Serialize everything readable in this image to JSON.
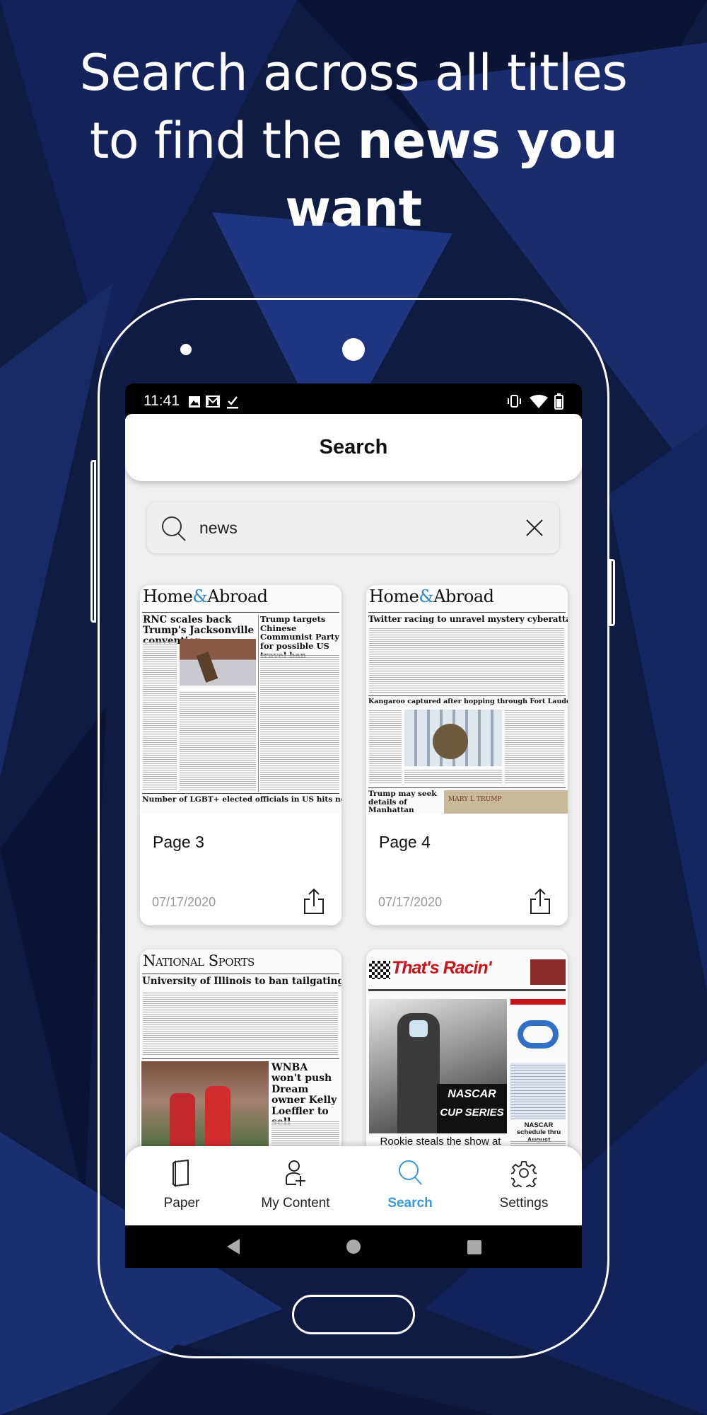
{
  "promo": {
    "line1": "Search across all titles",
    "line2_regular": "to find the ",
    "line2_bold": "news you",
    "line3_bold": "want"
  },
  "status_bar": {
    "time": "11:41",
    "icons": [
      "image-icon",
      "gmail-icon",
      "download-done-icon"
    ],
    "right_icons": [
      "vibrate-icon",
      "wifi-icon",
      "battery-icon"
    ]
  },
  "header": {
    "title": "Search"
  },
  "search": {
    "value": "news",
    "placeholder": "",
    "search_icon": "search-icon",
    "clear_icon": "close-icon"
  },
  "results": [
    {
      "page": "Page 3",
      "date": "07/17/2020",
      "paper": {
        "masthead_a": "Home",
        "masthead_amp": "&",
        "masthead_b": "Abroad",
        "headlines": [
          "RNC scales back Trump's Jacksonville convention",
          "Trump targets Chinese Communist Party for possible US travel ban",
          "Number of LGBT+ elected officials in US hits new high"
        ]
      }
    },
    {
      "page": "Page 4",
      "date": "07/17/2020",
      "paper": {
        "masthead_a": "Home",
        "masthead_amp": "&",
        "masthead_b": "Abroad",
        "headlines": [
          "Twitter racing to unravel mystery cyberattack",
          "Kangaroo captured after hopping through Fort Lauderdale streets",
          "Trump may seek details of Manhattan"
        ],
        "photo_text": "MARY L TRUMP"
      }
    },
    {
      "paper": {
        "masthead": "National Sports",
        "headlines": [
          "University of Illinois to ban tailgating",
          "WNBA won't push Dream owner Kelly Loeffler to sell"
        ]
      }
    },
    {
      "paper": {
        "masthead": "That's Racin'",
        "headlines": [
          "Rookie steals the show at Kentucky Speedway",
          "NASCAR schedule thru August"
        ],
        "logo_a": "NASCAR",
        "logo_b": "CUP SERIES"
      }
    }
  ],
  "bottom_nav": {
    "items": [
      {
        "label": "Paper",
        "icon": "paper-icon"
      },
      {
        "label": "My Content",
        "icon": "add-user-icon"
      },
      {
        "label": "Search",
        "icon": "search-icon",
        "active": true
      },
      {
        "label": "Settings",
        "icon": "gear-icon"
      }
    ]
  },
  "colors": {
    "accent": "#3a9ad9",
    "background": "#0d1a3f",
    "masthead_amp": "#2f86c8",
    "racin_red": "#c8141c"
  }
}
